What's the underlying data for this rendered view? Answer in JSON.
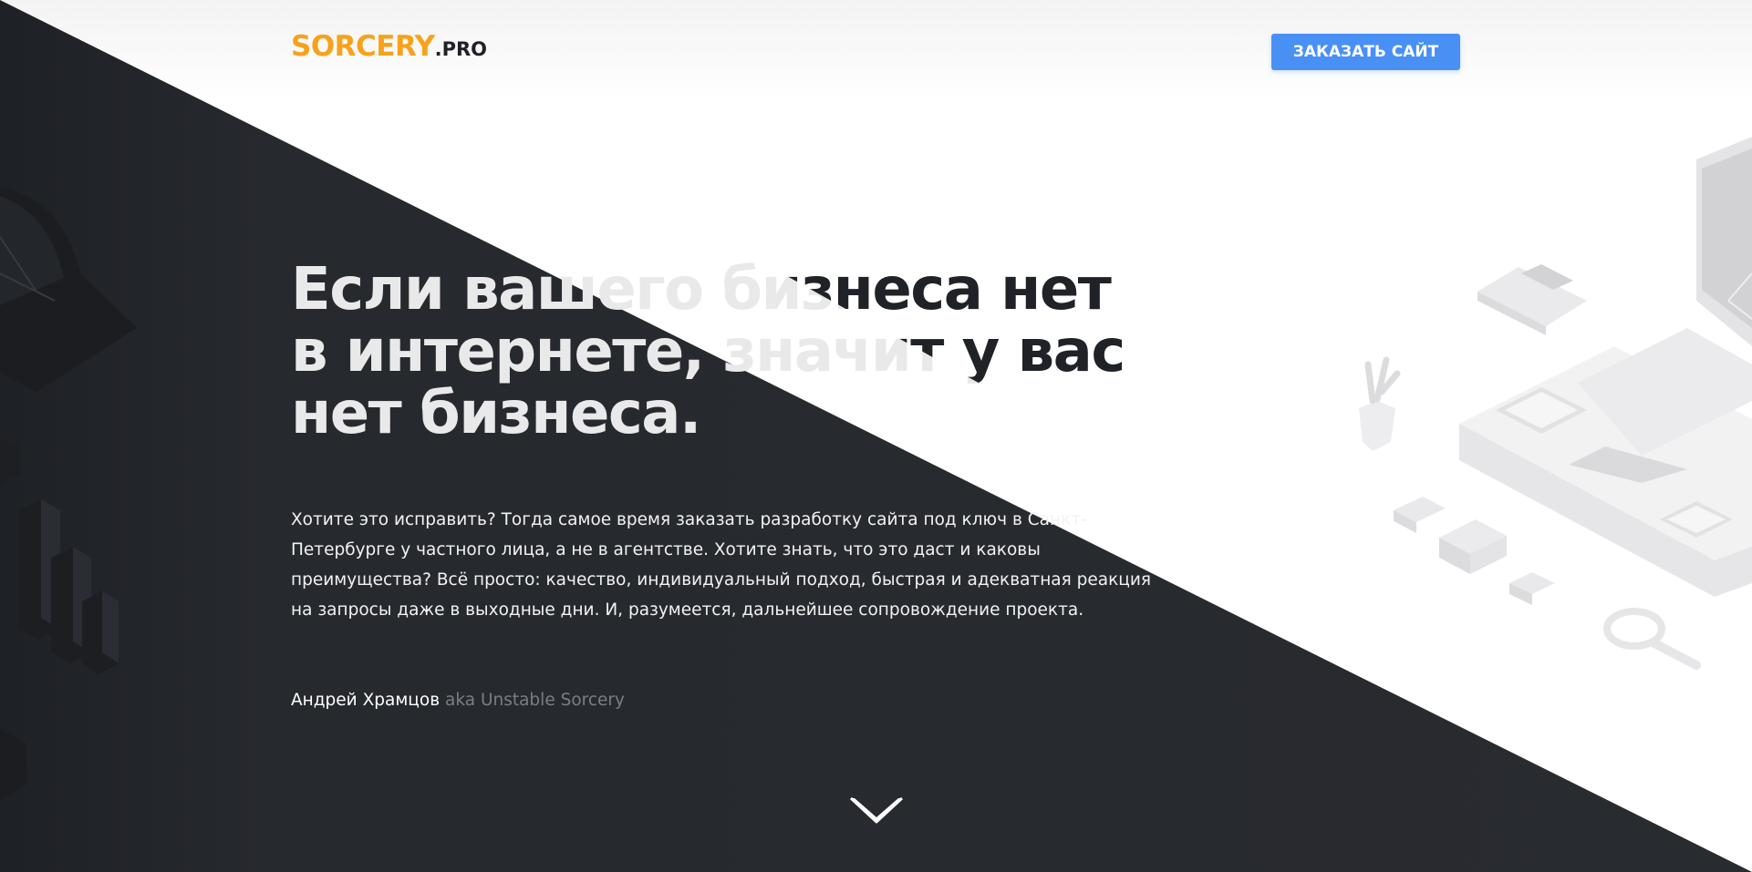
{
  "header": {
    "logo_main": "SORCERY",
    "logo_tld": ".PRO",
    "cta_label": "ЗАКАЗАТЬ САЙТ"
  },
  "hero": {
    "title_line1": "Если вашего бизнеса нет",
    "title_line2": "в интернете, значит у вас",
    "title_line3": "нет бизнеса.",
    "text_line1": "Хотите это исправить? Тогда самое время заказать разработку сайта под ключ в Санкт-",
    "text_line2": "Петербурге у частного лица, а не в агентстве. Хотите знать, что это даст и каковы",
    "text_line3": "преимущества? Всё просто: качество, индивидуальный подход, быстрая и адекватная реакция",
    "text_line4": "на запросы даже в выходные дни. И, разумеется, дальнейшее сопровождение проекта.",
    "author_name": "Андрей Храмцов",
    "author_alias": "aka Unstable Sorcery"
  },
  "icons": {
    "scroll": "chevron-down-icon",
    "left_illustration": "isometric-charts-illustration",
    "right_illustration": "isometric-laptop-illustration"
  },
  "colors": {
    "accent": "#f7a21b",
    "button": "#4990f5",
    "dark_bg": "#26292e"
  }
}
